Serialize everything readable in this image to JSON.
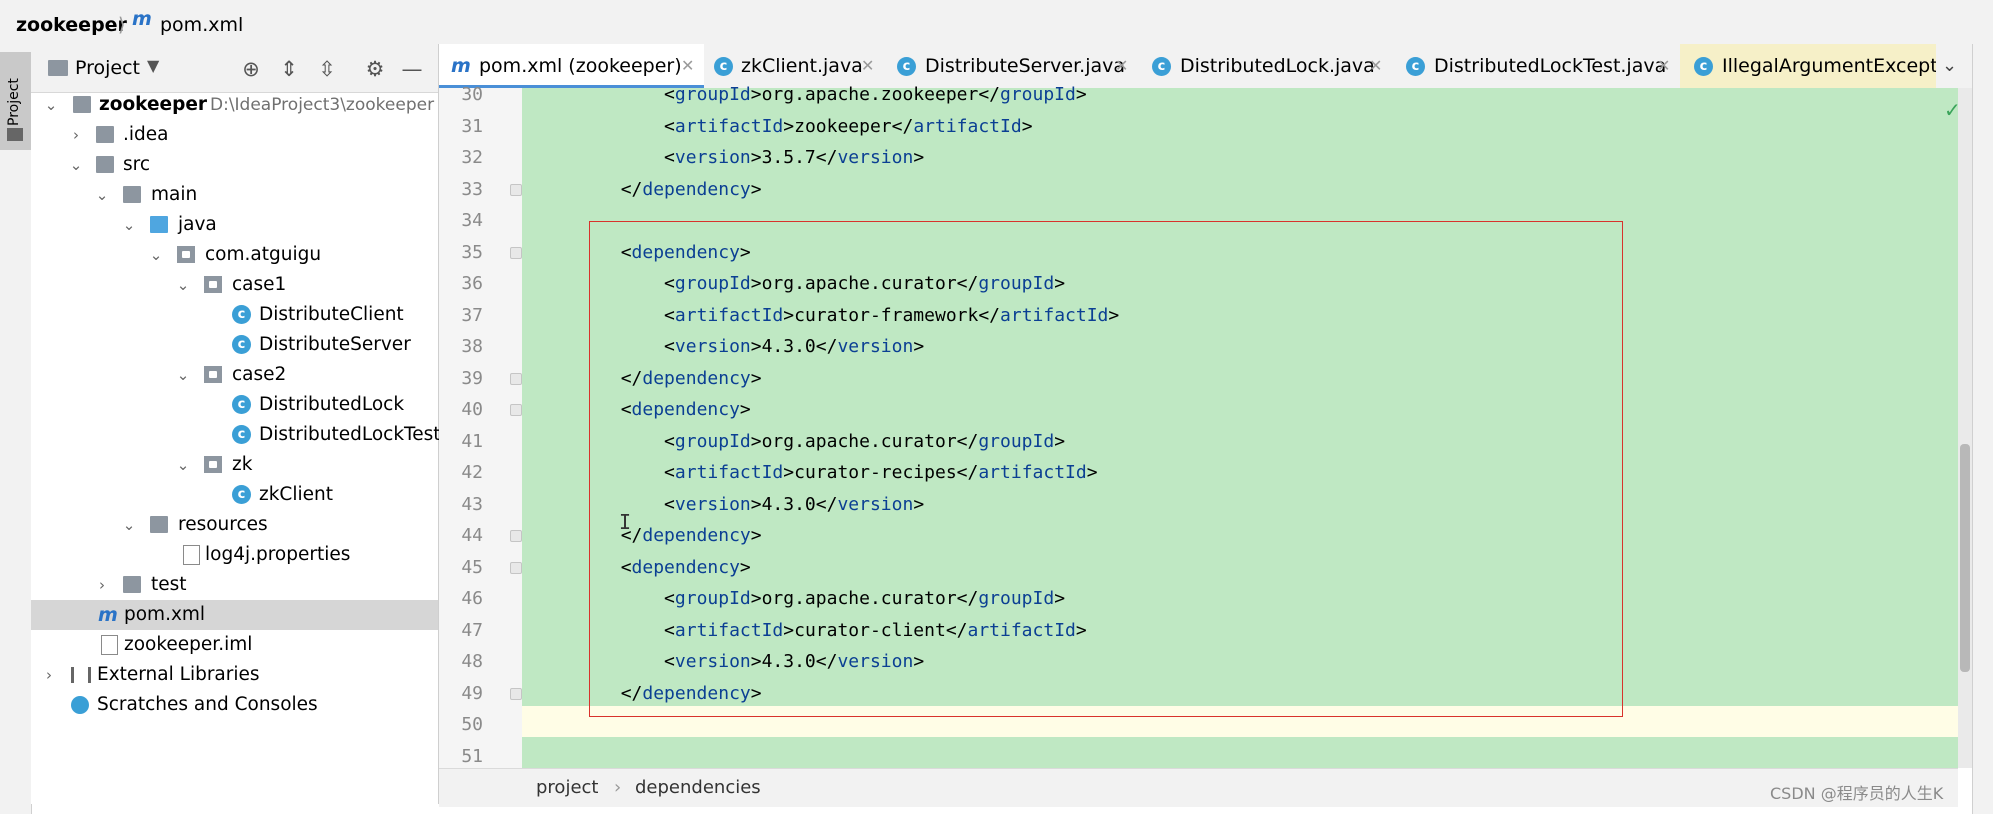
{
  "navbar": {
    "project": "zookeeper",
    "file": "pom.xml"
  },
  "left_stripe": {
    "tab_label": "Project"
  },
  "project_panel": {
    "title": "Project"
  },
  "tree": [
    {
      "name": "zookeeper",
      "hint": "D:\\IdeaProject3\\zookeeper"
    },
    {
      "name": ".idea"
    },
    {
      "name": "src"
    },
    {
      "name": "main"
    },
    {
      "name": "java"
    },
    {
      "name": "com.atguigu"
    },
    {
      "name": "case1"
    },
    {
      "name": "DistributeClient"
    },
    {
      "name": "DistributeServer"
    },
    {
      "name": "case2"
    },
    {
      "name": "DistributedLock"
    },
    {
      "name": "DistributedLockTest"
    },
    {
      "name": "zk"
    },
    {
      "name": "zkClient"
    },
    {
      "name": "resources"
    },
    {
      "name": "log4j.properties"
    },
    {
      "name": "test"
    },
    {
      "name": "pom.xml"
    },
    {
      "name": "zookeeper.iml"
    },
    {
      "name": "External Libraries"
    },
    {
      "name": "Scratches and Consoles"
    }
  ],
  "tabs": [
    {
      "label": "pom.xml (zookeeper)",
      "icon": "maven-icon"
    },
    {
      "label": "zkClient.java",
      "icon": "class-icon"
    },
    {
      "label": "DistributeServer.java",
      "icon": "class-icon"
    },
    {
      "label": "DistributedLock.java",
      "icon": "class-icon"
    },
    {
      "label": "DistributedLockTest.java",
      "icon": "class-icon"
    },
    {
      "label": "IllegalArgumentExcepti",
      "icon": "class-icon"
    }
  ],
  "editor": {
    "lines": [
      {
        "num": "30",
        "indent": "            ",
        "pre": "<",
        "tag": "groupId",
        "mid": ">org.apache.zookeeper</",
        "tag2": "groupId",
        "post": ">"
      },
      {
        "num": "31",
        "indent": "            ",
        "pre": "<",
        "tag": "artifactId",
        "mid": ">zookeeper</",
        "tag2": "artifactId",
        "post": ">"
      },
      {
        "num": "32",
        "indent": "            ",
        "pre": "<",
        "tag": "version",
        "mid": ">3.5.7</",
        "tag2": "version",
        "post": ">"
      },
      {
        "num": "33",
        "indent": "        ",
        "pre": "</",
        "tag": "dependency",
        "mid": ">",
        "tag2": "",
        "post": ""
      },
      {
        "num": "34",
        "indent": "",
        "pre": "",
        "tag": "",
        "mid": "",
        "tag2": "",
        "post": ""
      },
      {
        "num": "35",
        "indent": "        ",
        "pre": "<",
        "tag": "dependency",
        "mid": ">",
        "tag2": "",
        "post": ""
      },
      {
        "num": "36",
        "indent": "            ",
        "pre": "<",
        "tag": "groupId",
        "mid": ">org.apache.curator</",
        "tag2": "groupId",
        "post": ">"
      },
      {
        "num": "37",
        "indent": "            ",
        "pre": "<",
        "tag": "artifactId",
        "mid": ">curator-framework</",
        "tag2": "artifactId",
        "post": ">"
      },
      {
        "num": "38",
        "indent": "            ",
        "pre": "<",
        "tag": "version",
        "mid": ">4.3.0</",
        "tag2": "version",
        "post": ">"
      },
      {
        "num": "39",
        "indent": "        ",
        "pre": "</",
        "tag": "dependency",
        "mid": ">",
        "tag2": "",
        "post": ""
      },
      {
        "num": "40",
        "indent": "        ",
        "pre": "<",
        "tag": "dependency",
        "mid": ">",
        "tag2": "",
        "post": ""
      },
      {
        "num": "41",
        "indent": "            ",
        "pre": "<",
        "tag": "groupId",
        "mid": ">org.apache.curator</",
        "tag2": "groupId",
        "post": ">"
      },
      {
        "num": "42",
        "indent": "            ",
        "pre": "<",
        "tag": "artifactId",
        "mid": ">curator-recipes</",
        "tag2": "artifactId",
        "post": ">"
      },
      {
        "num": "43",
        "indent": "            ",
        "pre": "<",
        "tag": "version",
        "mid": ">4.3.0</",
        "tag2": "version",
        "post": ">"
      },
      {
        "num": "44",
        "indent": "        ",
        "pre": "</",
        "tag": "dependency",
        "mid": ">",
        "tag2": "",
        "post": ""
      },
      {
        "num": "45",
        "indent": "        ",
        "pre": "<",
        "tag": "dependency",
        "mid": ">",
        "tag2": "",
        "post": ""
      },
      {
        "num": "46",
        "indent": "            ",
        "pre": "<",
        "tag": "groupId",
        "mid": ">org.apache.curator</",
        "tag2": "groupId",
        "post": ">"
      },
      {
        "num": "47",
        "indent": "            ",
        "pre": "<",
        "tag": "artifactId",
        "mid": ">curator-client</",
        "tag2": "artifactId",
        "post": ">"
      },
      {
        "num": "48",
        "indent": "            ",
        "pre": "<",
        "tag": "version",
        "mid": ">4.3.0</",
        "tag2": "version",
        "post": ">"
      },
      {
        "num": "49",
        "indent": "        ",
        "pre": "</",
        "tag": "dependency",
        "mid": ">",
        "tag2": "",
        "post": ""
      },
      {
        "num": "50",
        "indent": "",
        "pre": "",
        "tag": "",
        "mid": "",
        "tag2": "",
        "post": ""
      },
      {
        "num": "51",
        "indent": "",
        "pre": "",
        "tag": "",
        "mid": "",
        "tag2": "",
        "post": ""
      }
    ]
  },
  "breadcrumb_bottom": {
    "first": "project",
    "second": "dependencies"
  },
  "watermark": "CSDN @程序员的人生K",
  "colors": {
    "code_bg": "#bfe8c3",
    "tag": "#0b3f93",
    "selection_border": "#d8322c",
    "accent": "#4a8fd7"
  }
}
